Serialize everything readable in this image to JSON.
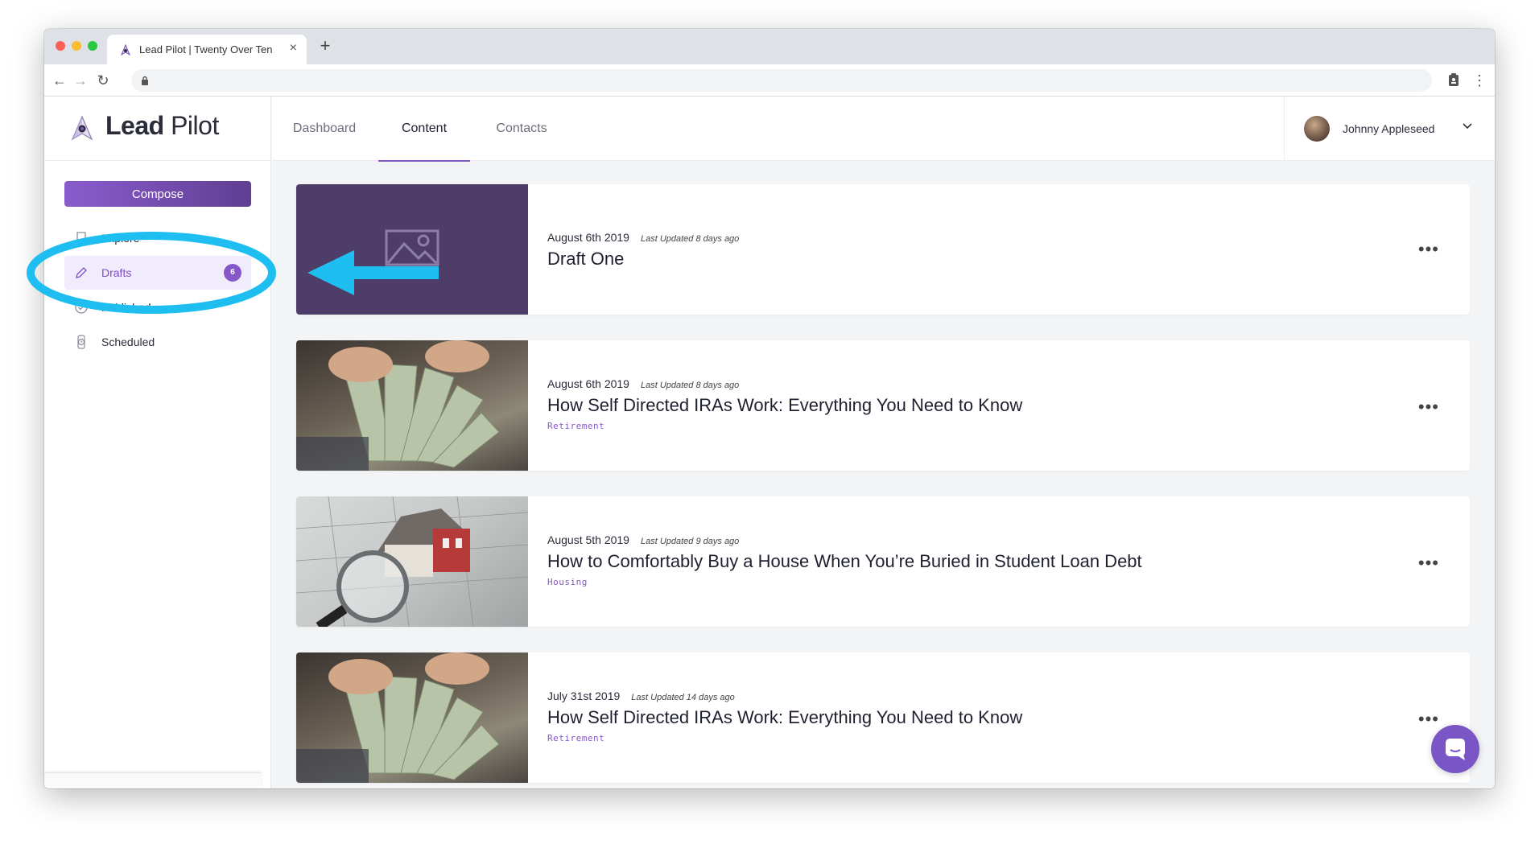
{
  "browser": {
    "tab_title": "Lead Pilot | Twenty Over Ten",
    "tab_close": "×",
    "new_tab": "+",
    "back": "←",
    "forward": "→",
    "reload": "↻",
    "menu": "⋮"
  },
  "app": {
    "logo_text_bold": "Lead",
    "logo_text": "Pilot",
    "compose_label": "Compose",
    "sidebar_items": [
      {
        "label": "Explore",
        "icon": "bookmark-icon"
      },
      {
        "label": "Drafts",
        "icon": "pencil-icon",
        "badge": "6"
      },
      {
        "label": "Published",
        "icon": "check-icon"
      },
      {
        "label": "Scheduled",
        "icon": "watch-icon"
      }
    ],
    "nav_tabs": [
      {
        "label": "Dashboard"
      },
      {
        "label": "Content",
        "active": true
      },
      {
        "label": "Contacts"
      }
    ],
    "user_name": "Johnny Appleseed",
    "accent_color": "#8657c9",
    "annotation_color": "#1ebef0"
  },
  "cards": [
    {
      "date": "August 6th 2019",
      "updated": "Last Updated 8 days ago",
      "title": "Draft One",
      "tag": "",
      "more": "•••"
    },
    {
      "date": "August 6th 2019",
      "updated": "Last Updated 8 days ago",
      "title": "How Self Directed IRAs Work: Everything You Need to Know",
      "tag": "Retirement",
      "more": "•••"
    },
    {
      "date": "August 5th 2019",
      "updated": "Last Updated 9 days ago",
      "title": "How to Comfortably Buy a House When You’re Buried in Student Loan Debt",
      "tag": "Housing",
      "more": "•••"
    },
    {
      "date": "July 31st 2019",
      "updated": "Last Updated 14 days ago",
      "title": "How Self Directed IRAs Work: Everything You Need to Know",
      "tag": "Retirement",
      "more": "•••"
    }
  ]
}
